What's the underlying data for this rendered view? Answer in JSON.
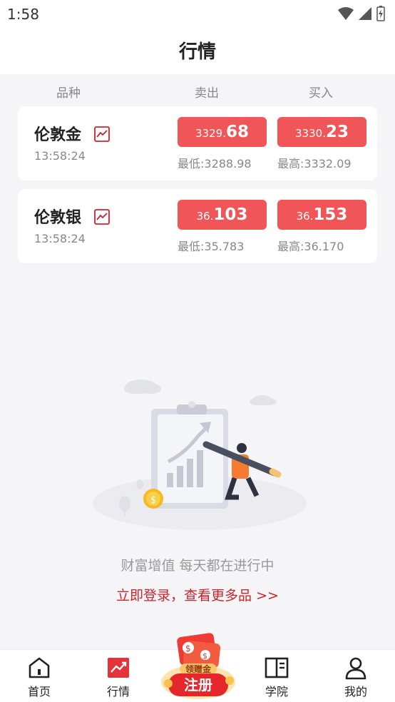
{
  "status": {
    "time": "1:58"
  },
  "header": {
    "title": "行情"
  },
  "columns": {
    "variety": "品种",
    "sell": "卖出",
    "buy": "买入"
  },
  "quotes": [
    {
      "name": "伦敦金",
      "time": "13:58:24",
      "sell_int": "3329.",
      "sell_dec": "68",
      "buy_int": "3330.",
      "buy_dec": "23",
      "low": "最低:3288.98",
      "high": "最高:3332.09"
    },
    {
      "name": "伦敦银",
      "time": "13:58:24",
      "sell_int": "36.",
      "sell_dec": "103",
      "buy_int": "36.",
      "buy_dec": "153",
      "low": "最低:35.783",
      "high": "最高:36.170"
    }
  ],
  "empty_state": {
    "text": "财富增值 每天都在进行中",
    "link": "立即登录，查看更多品 >>"
  },
  "promo": {
    "top_label": "领赠金",
    "main_label": "注册"
  },
  "tabbar": {
    "items": [
      {
        "label": "首页",
        "icon": "home-icon"
      },
      {
        "label": "行情",
        "icon": "market-icon"
      },
      {
        "label": "学院",
        "icon": "book-icon"
      },
      {
        "label": "我的",
        "icon": "user-icon"
      }
    ]
  },
  "colors": {
    "accent": "#f05558",
    "link": "#d0222c",
    "illustration_orange": "#f47b30"
  }
}
